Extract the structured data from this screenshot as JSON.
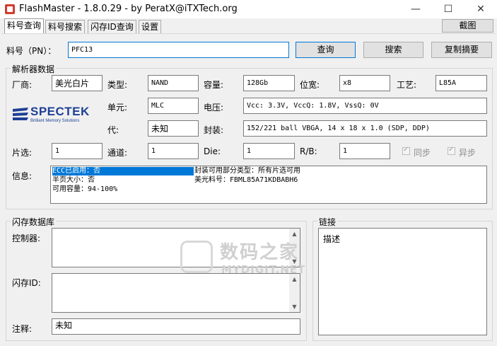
{
  "window": {
    "title": "FlashMaster - 1.8.0.29 - by PeratX@iTXTech.org",
    "minimize": "—",
    "maximize": "☐",
    "close": "✕"
  },
  "tabs": [
    "料号查询",
    "料号搜索",
    "闪存ID查询",
    "设置"
  ],
  "toolbar": {
    "screenshot_label": "截图"
  },
  "search": {
    "label": "料号（PN）：",
    "value": "PFC13",
    "query_label": "查询",
    "search_label": "搜索",
    "copy_label": "复制摘要"
  },
  "parser": {
    "title": "解析器数据",
    "vendor_label": "厂商:",
    "vendor_value": "美光白片",
    "type_label": "类型:",
    "type_value": "NAND",
    "capacity_label": "容量:",
    "capacity_value": "128Gb",
    "width_label": "位宽:",
    "width_value": "x8",
    "process_label": "工艺:",
    "process_value": "L85A",
    "logo_text": "SPECTEK",
    "logo_sub": "Brilliant Memory Solutions",
    "cell_label": "单元:",
    "cell_value": "MLC",
    "voltage_label": "电压:",
    "voltage_value": "Vcc: 3.3V, VccQ: 1.8V, VssQ: 0V",
    "gen_label": "代:",
    "gen_value": "未知",
    "package_label": "封装:",
    "package_value": "152/221 ball VBGA, 14 x 18 x 1.0 (SDP, DDP)",
    "ce_label": "片选:",
    "ce_value": "1",
    "channel_label": "通道:",
    "channel_value": "1",
    "die_label": "Die:",
    "die_value": "1",
    "rb_label": "R/B:",
    "rb_value": "1",
    "sync_label": "同步",
    "async_label": "异步",
    "info_label": "信息:",
    "info_lines_left": [
      "ECC已启用：否",
      "半页大小：否",
      "可用容量：94-100%"
    ],
    "info_lines_right": [
      "封装可用部分类型：所有片选可用",
      "美光料号：FBML85A71KDBABH6"
    ]
  },
  "flashdb": {
    "title": "闪存数据库",
    "controller_label": "控制器:",
    "flashid_label": "闪存ID:",
    "note_label": "注释:",
    "note_value": "未知"
  },
  "links": {
    "title": "链接",
    "desc_label": "描述"
  },
  "watermark": {
    "cn": "数码之家",
    "en": "MYDIGIT.NET"
  }
}
